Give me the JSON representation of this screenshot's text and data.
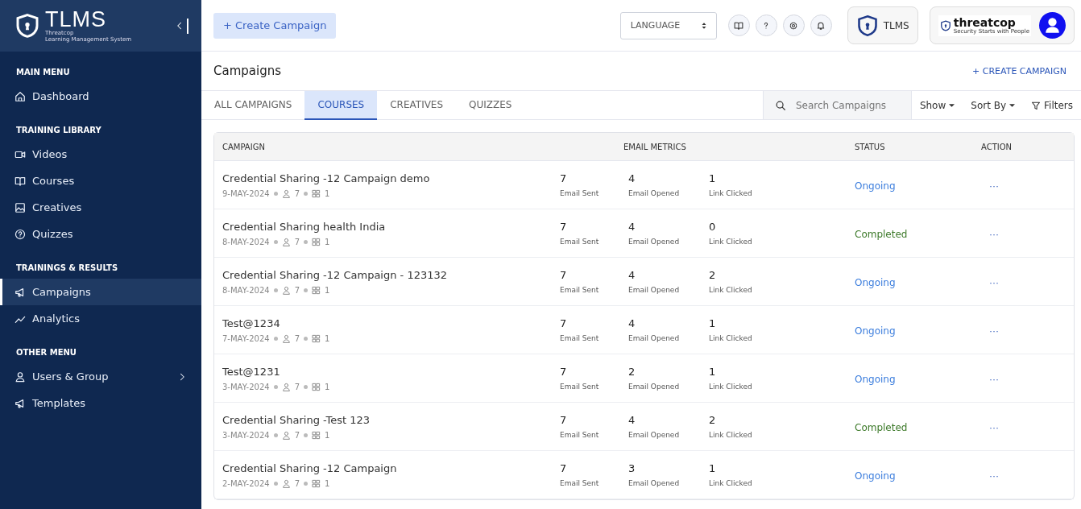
{
  "sidebar": {
    "logo": {
      "title": "TLMS",
      "line_1": "Threatcop",
      "line_2": "Learning Management System"
    },
    "sections": [
      {
        "heading": "MAIN MENU",
        "items": [
          {
            "label": "Dashboard",
            "selected": false,
            "expandable": false
          }
        ]
      },
      {
        "heading": "TRAINING LIBRARY",
        "items": [
          {
            "label": "Videos",
            "selected": false,
            "expandable": false
          },
          {
            "label": "Courses",
            "selected": false,
            "expandable": false
          },
          {
            "label": "Creatives",
            "selected": false,
            "expandable": false
          },
          {
            "label": "Quizzes",
            "selected": false,
            "expandable": false
          }
        ]
      },
      {
        "heading": "TRAININGS & RESULTS",
        "items": [
          {
            "label": "Campaigns",
            "selected": true,
            "expandable": false
          },
          {
            "label": "Analytics",
            "selected": false,
            "expandable": false
          }
        ]
      },
      {
        "heading": "OTHER MENU",
        "items": [
          {
            "label": "Users & Group",
            "selected": false,
            "expandable": true
          },
          {
            "label": "Templates",
            "selected": false,
            "expandable": false
          }
        ]
      }
    ]
  },
  "topbar": {
    "create_button": "+ Create Campaign",
    "language": "LANGUAGE",
    "app_badge": "TLMS",
    "brand": {
      "name": "threatcop",
      "tagline": "Security Starts with People"
    }
  },
  "page": {
    "title": "Campaigns",
    "create_link": "+ CREATE CAMPAIGN"
  },
  "tabs": [
    {
      "label": "ALL CAMPAIGNS",
      "selected": false
    },
    {
      "label": "COURSES",
      "selected": true
    },
    {
      "label": "CREATIVES",
      "selected": false
    },
    {
      "label": "QUIZZES",
      "selected": false
    }
  ],
  "search": {
    "placeholder": "Search Campaigns"
  },
  "toolbar": {
    "show": "Show",
    "sort": "Sort By",
    "filters": "Filters"
  },
  "table": {
    "columns": [
      "CAMPAIGN",
      "EMAIL METRICS",
      "STATUS",
      "ACTION"
    ],
    "rows": [
      {
        "name": "Credential Sharing -12 Campaign demo",
        "date": "9-MAY-2024",
        "users": "7",
        "groups": "1",
        "sent": "7",
        "sent_label": "Email Sent",
        "opened": "4",
        "opened_label": "Email Opened",
        "clicked": "1",
        "clicked_label": "Link Clicked",
        "status": "Ongoing",
        "kind": "ongoing",
        "action": "···"
      },
      {
        "name": "Credential Sharing health India",
        "date": "8-MAY-2024",
        "users": "7",
        "groups": "1",
        "sent": "7",
        "sent_label": "Email Sent",
        "opened": "4",
        "opened_label": "Email Opened",
        "clicked": "0",
        "clicked_label": "Link Clicked",
        "status": "Completed",
        "kind": "completed",
        "action": "···"
      },
      {
        "name": "Credential Sharing -12 Campaign - 123132",
        "date": "8-MAY-2024",
        "users": "7",
        "groups": "1",
        "sent": "7",
        "sent_label": "Email Sent",
        "opened": "4",
        "opened_label": "Email Opened",
        "clicked": "2",
        "clicked_label": "Link Clicked",
        "status": "Ongoing",
        "kind": "ongoing",
        "action": "···"
      },
      {
        "name": "Test@1234",
        "date": "7-MAY-2024",
        "users": "7",
        "groups": "1",
        "sent": "7",
        "sent_label": "Email Sent",
        "opened": "4",
        "opened_label": "Email Opened",
        "clicked": "1",
        "clicked_label": "Link Clicked",
        "status": "Ongoing",
        "kind": "ongoing",
        "action": "···"
      },
      {
        "name": "Test@1231",
        "date": "3-MAY-2024",
        "users": "7",
        "groups": "1",
        "sent": "7",
        "sent_label": "Email Sent",
        "opened": "2",
        "opened_label": "Email Opened",
        "clicked": "1",
        "clicked_label": "Link Clicked",
        "status": "Ongoing",
        "kind": "ongoing",
        "action": "···"
      },
      {
        "name": "Credential Sharing -Test 123",
        "date": "3-MAY-2024",
        "users": "7",
        "groups": "1",
        "sent": "7",
        "sent_label": "Email Sent",
        "opened": "4",
        "opened_label": "Email Opened",
        "clicked": "2",
        "clicked_label": "Link Clicked",
        "status": "Completed",
        "kind": "completed",
        "action": "···"
      },
      {
        "name": "Credential Sharing -12 Campaign",
        "date": "2-MAY-2024",
        "users": "7",
        "groups": "1",
        "sent": "7",
        "sent_label": "Email Sent",
        "opened": "3",
        "opened_label": "Email Opened",
        "clicked": "1",
        "clicked_label": "Link Clicked",
        "status": "Ongoing",
        "kind": "ongoing",
        "action": "···"
      }
    ]
  }
}
